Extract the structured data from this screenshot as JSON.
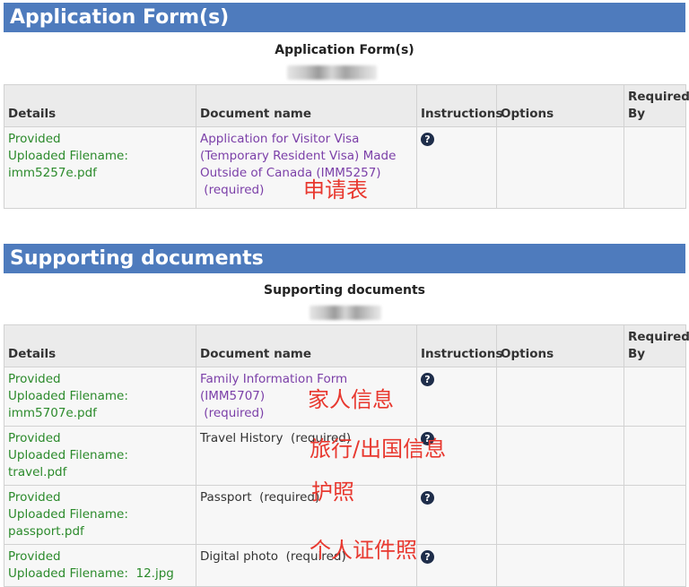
{
  "sections": [
    {
      "title": "Application Form(s)",
      "caption": "Application Form(s)",
      "headers": {
        "details": "Details",
        "document_name": "Document name",
        "instructions": "Instructions",
        "options": "Options",
        "required_by": "Required By"
      },
      "rows": [
        {
          "status": "Provided",
          "filename_label": "Uploaded Filename:",
          "filename": "imm5257e.pdf",
          "doc_name": "Application for Visitor Visa (Temporary Resident Visa) Made Outside of Canada (IMM5257)",
          "required": "(required)",
          "annotation": "申请表"
        }
      ]
    },
    {
      "title": "Supporting documents",
      "caption": "Supporting documents",
      "headers": {
        "details": "Details",
        "document_name": "Document name",
        "instructions": "Instructions",
        "options": "Options",
        "required_by": "Required By"
      },
      "rows": [
        {
          "status": "Provided",
          "filename_label": "Uploaded Filename:",
          "filename": "imm5707e.pdf",
          "doc_name": "Family Information Form (IMM5707)",
          "required": "(required)",
          "annotation": "家人信息"
        },
        {
          "status": "Provided",
          "filename_label": "Uploaded Filename:",
          "filename": "travel.pdf",
          "doc_name": "Travel History",
          "required": "(required)",
          "annotation": "旅行/出国信息"
        },
        {
          "status": "Provided",
          "filename_label": "Uploaded Filename:",
          "filename": "passport.pdf",
          "doc_name": "Passport",
          "required": "(required)",
          "annotation": "护照"
        },
        {
          "status": "Provided",
          "filename_label": "Uploaded Filename:",
          "filename": "12.jpg",
          "doc_name": "Digital photo",
          "required": "(required)",
          "annotation": "个人证件照"
        }
      ]
    }
  ],
  "icons": {
    "help": "question-circle-icon"
  },
  "colors": {
    "header_bar": "#4e7bbd",
    "provided": "#2b8a2b",
    "form_link": "#7b3fa8",
    "annotation": "#e8382f"
  }
}
